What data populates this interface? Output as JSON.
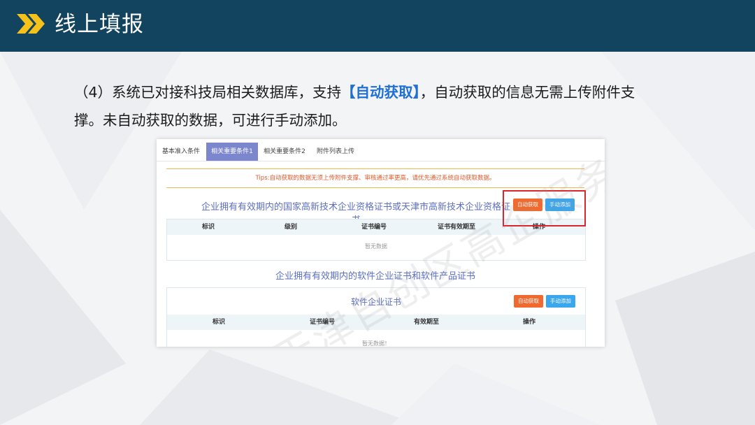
{
  "header": {
    "title": "线上填报"
  },
  "intro": {
    "prefix": "（4）系统已对接科技局相关数据库，支持",
    "highlight": "【自动获取】",
    "suffix": "，自动获取的信息无需上传附件支撑。未自动获取的数据，可进行手动添加。"
  },
  "screenshot": {
    "tabs": [
      "基本准入条件",
      "相关重要条件1",
      "相关重要条件2",
      "附件列表上传"
    ],
    "tips": "Tips:自动获取的数据无须上传附件支撑、审核通过率更高，请优先通过系统自动获取数据。",
    "section1": {
      "title": "企业拥有有效期内的国家高新技术企业资格证书或天津市高新技术企业资格证书",
      "auto_btn": "自动获取",
      "manual_btn": "手动添加",
      "headers": [
        "标识",
        "级别",
        "证书编号",
        "证书有效期至",
        "操作"
      ],
      "empty": "暂无数据"
    },
    "section2": {
      "title": "企业拥有有效期内的软件企业证书和软件产品证书",
      "subtitle": "软件企业证书",
      "auto_btn": "自动获取",
      "manual_btn": "手动添加",
      "headers": [
        "标识",
        "证书编号",
        "有效期至",
        "操作"
      ],
      "empty": "暂无数据！"
    },
    "watermark": "天津自创区高企服务中心"
  },
  "colors": {
    "header_bg": "#13445f",
    "accent_yellow": "#f5c21b",
    "highlight_blue": "#1f6fd6",
    "tab_active": "#7b86cc",
    "btn_auto": "#f06a2f",
    "btn_manual": "#3aa6ee",
    "callout_red": "#d8262c"
  }
}
